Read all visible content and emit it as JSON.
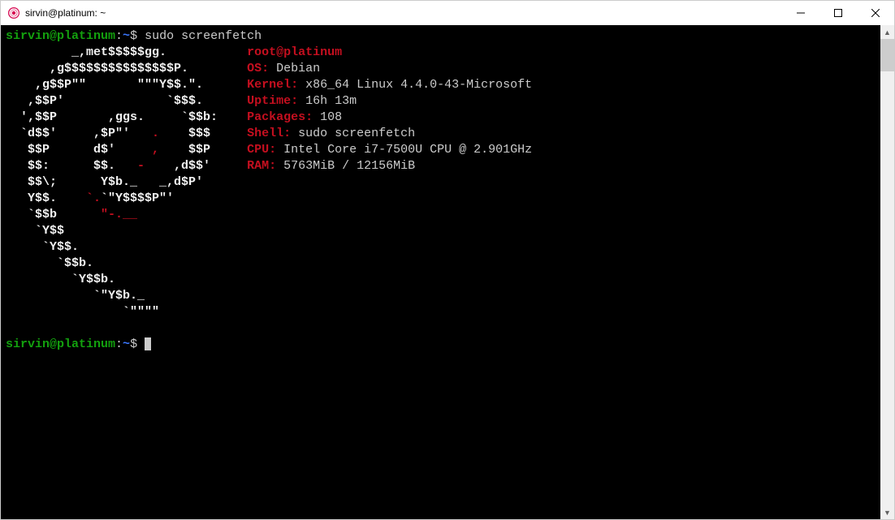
{
  "window": {
    "title": "sirvin@platinum: ~"
  },
  "prompt1": {
    "user_host": "sirvin@platinum",
    "colon": ":",
    "path": "~",
    "dollar": "$ ",
    "command": "sudo screenfetch"
  },
  "logo": {
    "l0": "         _,met$$$$$gg.           ",
    "l1": "      ,g$$$$$$$$$$$$$$$P.        ",
    "l2": "    ,g$$P\"\"       \"\"\"Y$$.\".      ",
    "l3": "   ,$$P'              `$$$.      ",
    "l4": "  ',$$P       ,ggs.     `$$b:    ",
    "l5": "  `d$$'     ,$P\"'   .    $$$     ",
    "l6": "   $$P      d$'     ,    $$P     ",
    "l7": "   $$:      $$.   -    ,d$$'     ",
    "l8": "   $$\\;      Y$b._   _,d$P'      ",
    "l9": "   Y$$.    `.`\"Y$$$$P\"'          ",
    "l10": "   `$$b      \"-.__               ",
    "l11": "    `Y$$                         ",
    "l12": "     `Y$$.                       ",
    "l13": "       `$$b.                     ",
    "l14": "         `Y$$b.                  ",
    "l15": "            `\"Y$b._              ",
    "l16": "                `\"\"\"\"            "
  },
  "accent": {
    "a5": ".",
    "a6": ",",
    "a7": "-",
    "a9": "`.",
    "a10": "\"-.__"
  },
  "info": {
    "user": "root",
    "at": "@",
    "host": "platinum",
    "os_label": "OS:",
    "os_value": " Debian",
    "kernel_label": "Kernel:",
    "kernel_value": " x86_64 Linux 4.4.0-43-Microsoft",
    "uptime_label": "Uptime:",
    "uptime_value": " 16h 13m",
    "packages_label": "Packages:",
    "packages_value": " 108",
    "shell_label": "Shell:",
    "shell_value": " sudo screenfetch",
    "cpu_label": "CPU:",
    "cpu_value": " Intel Core i7-7500U CPU @ 2.901GHz",
    "ram_label": "RAM:",
    "ram_value": " 5763MiB / 12156MiB"
  },
  "prompt2": {
    "user_host": "sirvin@platinum",
    "colon": ":",
    "path": "~",
    "dollar": "$ "
  }
}
